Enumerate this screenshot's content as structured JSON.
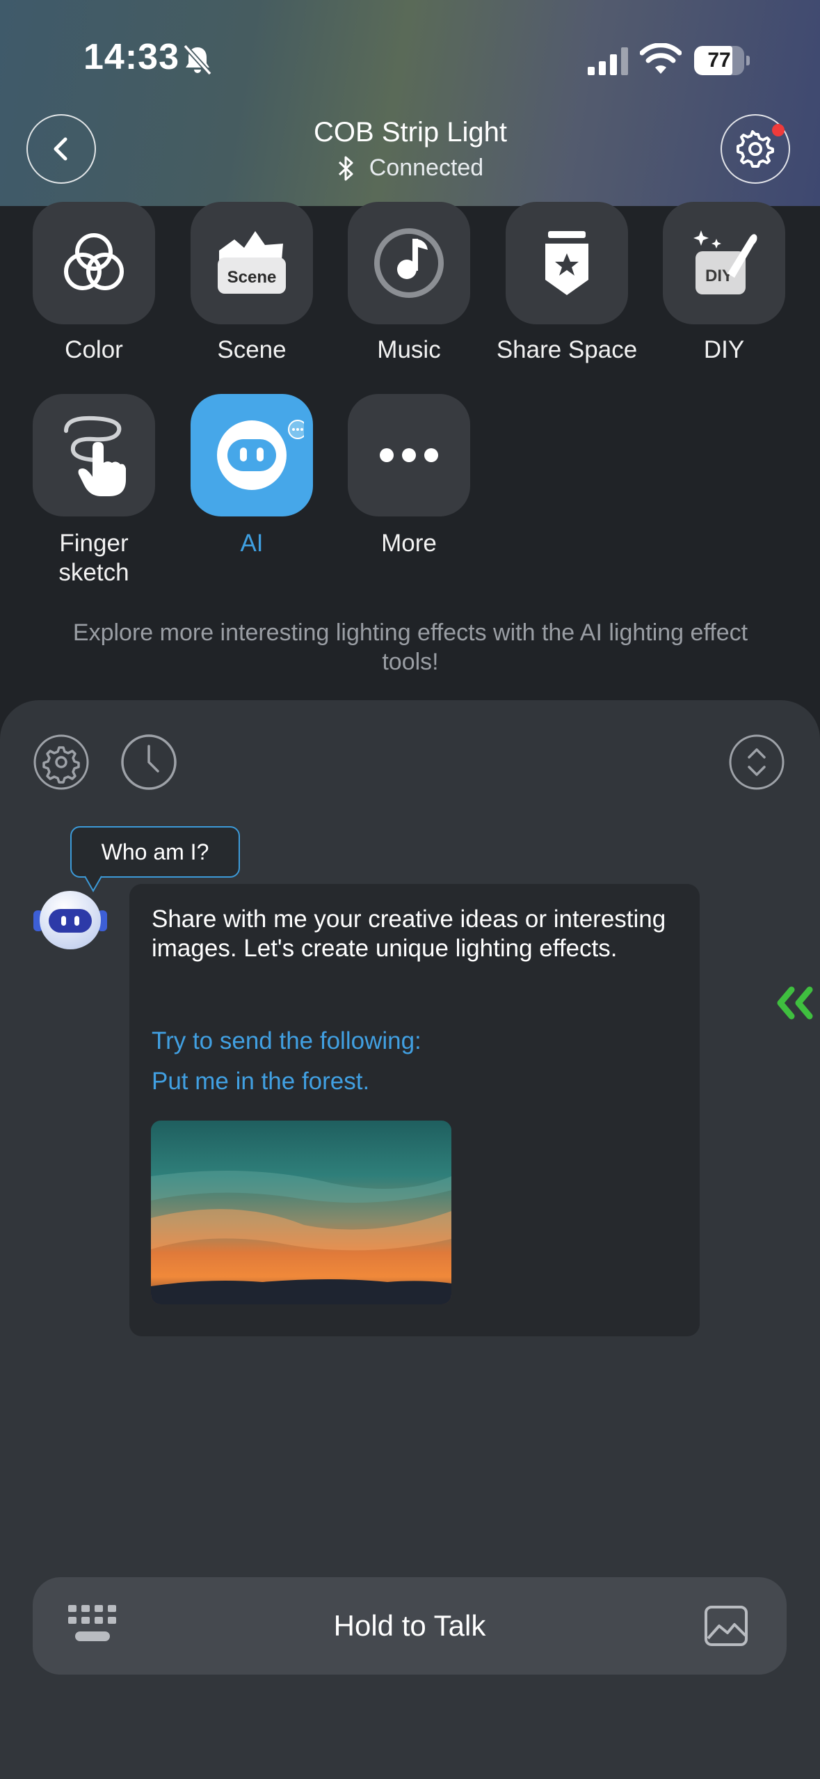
{
  "status_bar": {
    "time": "14:33",
    "battery": "77",
    "battery_level": 0.77,
    "icons": [
      "bell-slash-icon",
      "cellular-signal-icon",
      "wifi-icon",
      "battery-icon"
    ]
  },
  "header": {
    "title": "COB Strip Light",
    "connection_status": "Connected",
    "back_icon": "chevron-left-icon",
    "settings_icon": "gear-icon",
    "bluetooth_icon": "bluetooth-icon",
    "notification_dot_color": "#ef3b3b"
  },
  "features": [
    {
      "label": "Color",
      "icon": "color-circles-icon"
    },
    {
      "label": "Scene",
      "icon": "scene-icon",
      "icon_text": "Scene"
    },
    {
      "label": "Music",
      "icon": "music-icon"
    },
    {
      "label": "Share Space",
      "icon": "share-space-icon"
    },
    {
      "label": "DIY",
      "icon": "diy-icon",
      "icon_text": "DIY"
    },
    {
      "label": "Finger\nsketch",
      "icon": "finger-sketch-icon"
    },
    {
      "label": "AI",
      "icon": "robot-icon",
      "active": true
    },
    {
      "label": "More",
      "icon": "more-dots-icon"
    }
  ],
  "promo_text": "Explore more interesting lighting effects with the AI lighting effect tools!",
  "assistant": {
    "tools": [
      "settings-icon",
      "history-clock-icon",
      "expand-collapse-icon"
    ],
    "who_am_i": "Who am I?",
    "message": "Share with me your creative ideas or interesting images. Let's create unique lighting effects.",
    "hint": "Try to send the following:",
    "example": "Put me in the forest.",
    "example_image": "sunset-image"
  },
  "input_bar": {
    "label": "Hold to Talk",
    "left_icon": "keyboard-icon",
    "right_icon": "image-icon"
  },
  "colors": {
    "accent": "#46a7e9",
    "link": "#41a0e2",
    "side_chevron": "#3fbf3f",
    "background": "#202327",
    "panel": "#32363b"
  }
}
